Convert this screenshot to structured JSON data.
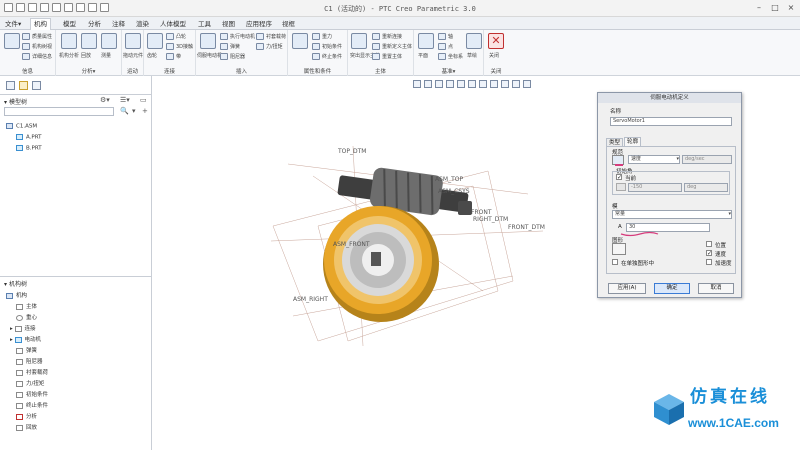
{
  "titlebar": {
    "title": "C1 (活动的) - PTC Creo Parametric 3.0"
  },
  "menu": {
    "items": [
      "文件▾",
      "机构",
      "模型",
      "分析",
      "注释",
      "渲染",
      "人体模型",
      "工具",
      "视图",
      "应用程序",
      "视框"
    ]
  },
  "ribbon": {
    "groups": [
      {
        "label": "信息",
        "buttons": [
          "质量属性",
          "机构树视",
          "详细信息"
        ]
      },
      {
        "label": "分析▾",
        "buttons": [
          "机构分析",
          "回放",
          "测量"
        ]
      },
      {
        "label": "运动",
        "buttons": [
          "拖动元件"
        ]
      },
      {
        "label": "连接",
        "buttons": [
          "齿轮",
          "凸轮",
          "3D接触",
          "带"
        ]
      },
      {
        "label": "插入",
        "buttons": [
          "伺服电动机",
          "执行电动机",
          "弹簧",
          "阻尼器",
          "衬套载荷",
          "力/扭矩"
        ]
      },
      {
        "label": "属性和条件",
        "buttons": [
          "重力",
          "初始条件",
          "终止条件"
        ]
      },
      {
        "label": "主体",
        "buttons": [
          "突出显示主体",
          "重新连接",
          "重新定义主体",
          "重置主体"
        ]
      },
      {
        "label": "基准▾",
        "buttons": [
          "平面",
          "轴",
          "点",
          "坐标系",
          "草绘"
        ]
      },
      {
        "label": "关闭",
        "buttons": [
          "关闭"
        ]
      }
    ]
  },
  "model_tree": {
    "header": "模型树",
    "items": [
      "C1.ASM",
      "A.PRT",
      "B.PRT"
    ]
  },
  "mech_tree": {
    "header": "机构树",
    "items": [
      "机构",
      "主体",
      "重心",
      "连接",
      "电动机",
      "弹簧",
      "阻尼器",
      "衬套载荷",
      "力/扭矩",
      "初始条件",
      "终止条件",
      "分析",
      "回放"
    ]
  },
  "viewport_labels": [
    "TOP_DTM",
    "ASM_TOP",
    "ASM_CSYS",
    "FRONT",
    "RIGHT_DTM",
    "FRONT_DTM",
    "ASM_RIGHT",
    "ASM_FRONT"
  ],
  "dialog": {
    "title": "伺服电动机定义",
    "name_label": "名称",
    "name_value": "ServoMotor1",
    "tabs": [
      "类型",
      "轮廓"
    ],
    "spec_label": "规范",
    "spec_value": "速度",
    "spec_unit": "deg/sec",
    "initial_label": "初始角",
    "current_label": "当前",
    "initial_value": "-150",
    "initial_unit": "deg",
    "magnitude_label": "模",
    "magnitude_type": "常量",
    "a_label": "A",
    "a_value": "30",
    "graph_label": "图形",
    "graph_checks": [
      {
        "label": "位置",
        "checked": false
      },
      {
        "label": "速度",
        "checked": true
      },
      {
        "label": "加速度",
        "checked": false
      }
    ],
    "separate_label": "在单独图形中",
    "buttons": [
      "应用(A)",
      "确定",
      "取消"
    ]
  },
  "watermark": {
    "cn": "仿真在线",
    "en": "www.1CAE.com"
  },
  "colors": {
    "gear_gold": "#e8a628",
    "worm_gray": "#6d6d6d",
    "accent_blue": "#1a8fd8",
    "annotation_pink": "#d63c7c"
  }
}
